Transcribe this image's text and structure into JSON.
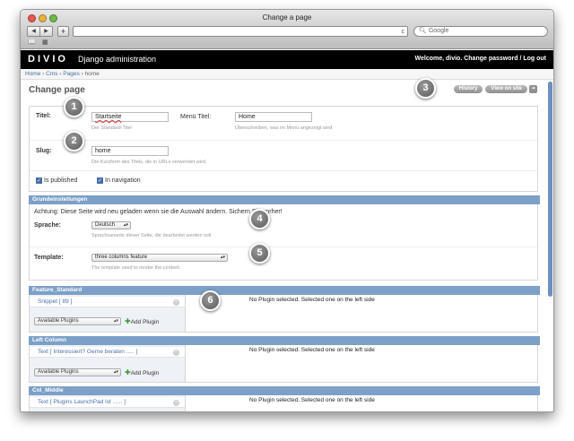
{
  "window": {
    "title": "Change a page"
  },
  "browser": {
    "back": "◀",
    "forward": "▶",
    "add": "+",
    "reload": "c",
    "search_placeholder": "Google"
  },
  "header": {
    "logo": "DIVIO",
    "title": "Django administration",
    "user_links": "Welcome, divio. Change password / Log out"
  },
  "breadcrumbs": [
    "Home",
    "Cms",
    "Pages",
    "home"
  ],
  "page_title": "Change page",
  "object_tools": {
    "history": "History",
    "view_on_site": "View on site",
    "arrow": "➔"
  },
  "form": {
    "titel_label": "Titel:",
    "titel_value": "Startseite",
    "titel_help": "Der Standard-Titel",
    "menu_title_label": "Menü Titel:",
    "menu_title_value": "Home",
    "menu_title_help": "Überschreiben, was im Menü angezeigt wird",
    "slug_label": "Slug:",
    "slug_value": "home",
    "slug_help": "Die Kurzform des Titels, die in URLs verwendet wird.",
    "published_label": "Is published",
    "navigation_label": "In navigation"
  },
  "grundeinstellungen": {
    "heading": "Grundeinstellungen",
    "warning": "Achtung: Diese Seite wird neu geladen wenn sie die Auswahl ändern. Sichern Sie vorher!",
    "language_label": "Sprache:",
    "language_value": "Deutsch",
    "language_help": "Sprachvariante dieser Seite, die bearbeitet werden soll.",
    "template_label": "Template:",
    "template_value": "three columns feature",
    "template_help": "The template used to render the content."
  },
  "placeholders": [
    {
      "heading": "Feature_Standard",
      "plugin": "Snippet [ 89 ]",
      "select": "Available Plugins",
      "add": "Add Plugin",
      "empty": "No Plugin selected. Selected one on the left side"
    },
    {
      "heading": "Left Column",
      "plugin": "Text [ Interessiert? Gerne beraten ..... ]",
      "select": "Available Plugins",
      "add": "Add Plugin",
      "empty": "No Plugin selected. Selected one on the left side"
    },
    {
      "heading": "Col_Middle",
      "plugin": "Text [ Plugins LaunchPad ist ...... ]",
      "empty": "No Plugin selected. Selected one on the left side"
    }
  ],
  "callouts": [
    "1",
    "2",
    "3",
    "4",
    "5",
    "6"
  ],
  "colors": {
    "header_bg": "#000000",
    "section_header": "#7ca0c7",
    "link": "#3a6fa0",
    "callout": "#6a6a6a"
  }
}
